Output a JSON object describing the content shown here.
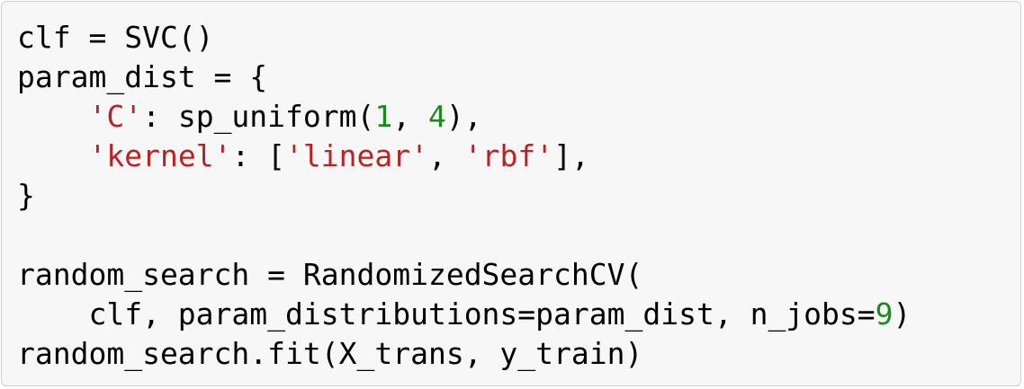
{
  "code": {
    "lines": [
      [
        {
          "t": "clf = SVC()",
          "k": "plain"
        }
      ],
      [
        {
          "t": "param_dist = {",
          "k": "plain"
        }
      ],
      [
        {
          "t": "    ",
          "k": "plain"
        },
        {
          "t": "'C'",
          "k": "str"
        },
        {
          "t": ": sp_uniform(",
          "k": "plain"
        },
        {
          "t": "1",
          "k": "num"
        },
        {
          "t": ", ",
          "k": "plain"
        },
        {
          "t": "4",
          "k": "num"
        },
        {
          "t": "),",
          "k": "plain"
        }
      ],
      [
        {
          "t": "    ",
          "k": "plain"
        },
        {
          "t": "'kernel'",
          "k": "str"
        },
        {
          "t": ": [",
          "k": "plain"
        },
        {
          "t": "'linear'",
          "k": "str"
        },
        {
          "t": ", ",
          "k": "plain"
        },
        {
          "t": "'rbf'",
          "k": "str"
        },
        {
          "t": "],",
          "k": "plain"
        }
      ],
      [
        {
          "t": "}",
          "k": "plain"
        }
      ],
      [
        {
          "t": "",
          "k": "plain"
        }
      ],
      [
        {
          "t": "random_search = RandomizedSearchCV(",
          "k": "plain"
        }
      ],
      [
        {
          "t": "    clf, param_distributions=param_dist, n_jobs=",
          "k": "plain"
        },
        {
          "t": "9",
          "k": "num"
        },
        {
          "t": ")",
          "k": "plain"
        }
      ],
      [
        {
          "t": "random_search.fit(X_trans, y_train)",
          "k": "plain"
        }
      ]
    ]
  },
  "colors": {
    "background": "#f7f7f7",
    "border": "#cfcfcf",
    "text": "#000000",
    "string": "#ba2121",
    "number": "#1a8a1a"
  }
}
